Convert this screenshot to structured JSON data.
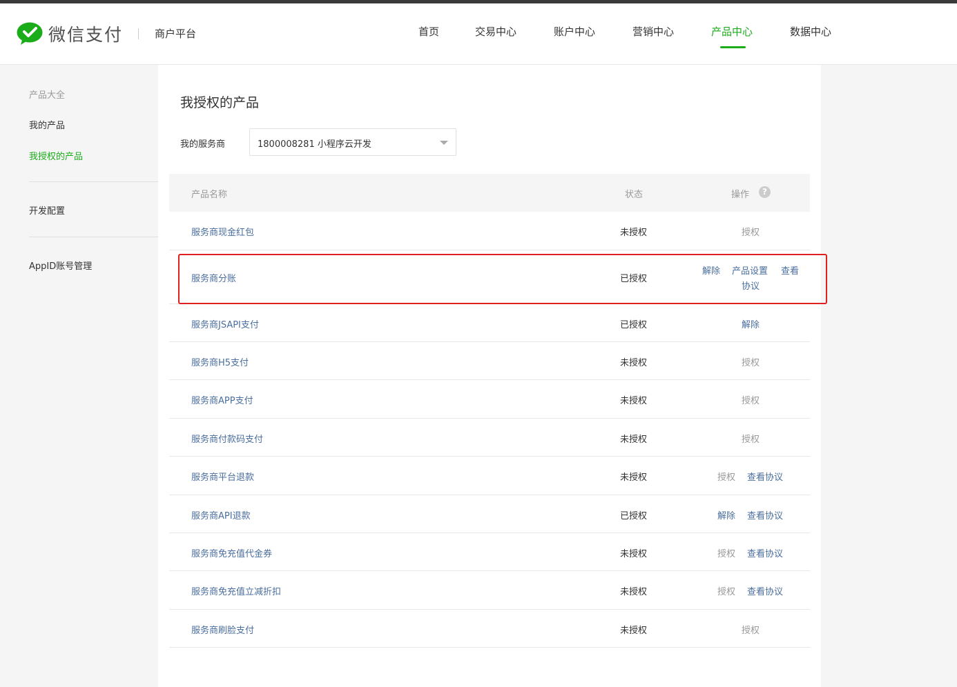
{
  "brand": {
    "logo_text": "微信支付",
    "sub_title": "商户平台"
  },
  "nav": [
    {
      "label": "首页",
      "active": false
    },
    {
      "label": "交易中心",
      "active": false
    },
    {
      "label": "账户中心",
      "active": false
    },
    {
      "label": "营销中心",
      "active": false
    },
    {
      "label": "产品中心",
      "active": true
    },
    {
      "label": "数据中心",
      "active": false
    }
  ],
  "sidebar": {
    "items": [
      {
        "label": "产品大全"
      },
      {
        "label": "我的产品"
      },
      {
        "label": "我授权的产品"
      },
      {
        "label": "开发配置"
      },
      {
        "label": "AppID账号管理"
      }
    ]
  },
  "main": {
    "title": "我授权的产品",
    "provider_label": "我的服务商",
    "provider_value": "1800008281 小程序云开发",
    "table": {
      "headers": {
        "name": "产品名称",
        "status": "状态",
        "action": "操作"
      },
      "help_glyph": "?",
      "rows": [
        {
          "name": "服务商现金红包",
          "status": "未授权",
          "actions": [
            "授权"
          ]
        },
        {
          "name": "服务商分账",
          "status": "已授权",
          "actions": [
            "解除",
            "产品设置",
            "查看",
            "协议"
          ]
        },
        {
          "name": "服务商JSAPI支付",
          "status": "已授权",
          "actions": [
            "解除"
          ]
        },
        {
          "name": "服务商H5支付",
          "status": "未授权",
          "actions": [
            "授权"
          ]
        },
        {
          "name": "服务商APP支付",
          "status": "未授权",
          "actions": [
            "授权"
          ]
        },
        {
          "name": "服务商付款码支付",
          "status": "未授权",
          "actions": [
            "授权"
          ]
        },
        {
          "name": "服务商平台退款",
          "status": "未授权",
          "actions": [
            "授权",
            "查看协议"
          ]
        },
        {
          "name": "服务商API退款",
          "status": "已授权",
          "actions": [
            "解除",
            "查看协议"
          ]
        },
        {
          "name": "服务商免充值代金券",
          "status": "未授权",
          "actions": [
            "授权",
            "查看协议"
          ]
        },
        {
          "name": "服务商免充值立减折扣",
          "status": "未授权",
          "actions": [
            "授权",
            "查看协议"
          ]
        },
        {
          "name": "服务商刷脸支付",
          "status": "未授权",
          "actions": [
            "授权"
          ]
        }
      ]
    }
  },
  "colors": {
    "brand_green": "#1aad19",
    "link_blue": "#4a6e9e",
    "highlight_red": "#e02020"
  }
}
